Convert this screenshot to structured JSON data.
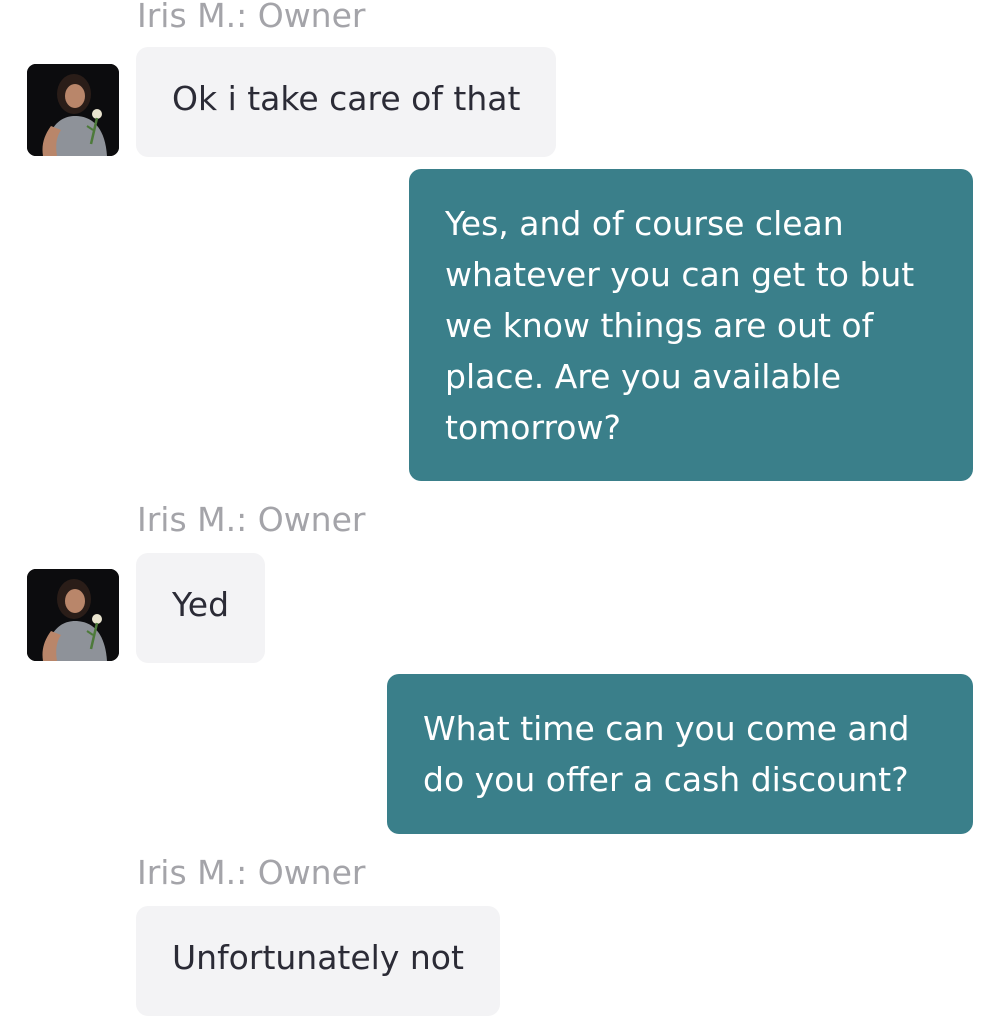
{
  "conversation": {
    "messages": [
      {
        "direction": "incoming",
        "sender": "Iris M.: Owner",
        "avatar": "owner-avatar",
        "text": "Ok i take care of that"
      },
      {
        "direction": "outgoing",
        "lines": [
          "Yes, and of course clean",
          "whatever you can get to but",
          "we know things are out of",
          "place.  Are you available",
          "tomorrow?"
        ]
      },
      {
        "direction": "incoming",
        "sender": "Iris M.: Owner",
        "avatar": "owner-avatar",
        "text": "Yed"
      },
      {
        "direction": "outgoing",
        "lines": [
          "What time can you come and",
          "do you offer a cash discount?"
        ]
      },
      {
        "direction": "incoming",
        "sender": "Iris M.: Owner",
        "text": "Unfortunately not"
      }
    ]
  },
  "colors": {
    "outgoing_bubble": "#3a7f8a",
    "incoming_bubble": "#f3f3f5",
    "sender_label": "#a4a4a9"
  }
}
